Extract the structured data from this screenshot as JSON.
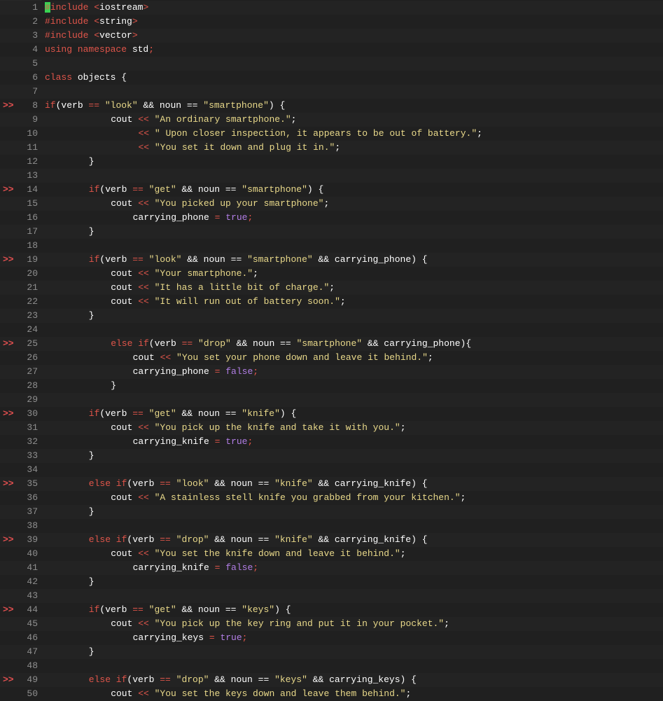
{
  "editor": {
    "language": "C++",
    "marker_glyph": ">>",
    "cursor_line": 1,
    "lines": [
      {
        "num": "1",
        "marker": false,
        "indent": 0,
        "tokens": [
          [
            "cursor",
            "#"
          ],
          [
            "pre",
            "include "
          ],
          [
            "op",
            "<"
          ],
          [
            "id",
            "iostream"
          ],
          [
            "op",
            ">"
          ]
        ]
      },
      {
        "num": "2",
        "marker": false,
        "indent": 0,
        "tokens": [
          [
            "pre",
            "#include "
          ],
          [
            "op",
            "<"
          ],
          [
            "id",
            "string"
          ],
          [
            "op",
            ">"
          ]
        ]
      },
      {
        "num": "3",
        "marker": false,
        "indent": 0,
        "tokens": [
          [
            "pre",
            "#include "
          ],
          [
            "op",
            "<"
          ],
          [
            "id",
            "vector"
          ],
          [
            "op",
            ">"
          ]
        ]
      },
      {
        "num": "4",
        "marker": false,
        "indent": 0,
        "tokens": [
          [
            "kw",
            "using namespace "
          ],
          [
            "id",
            "std"
          ],
          [
            "sem",
            ";"
          ]
        ]
      },
      {
        "num": "5",
        "marker": false,
        "indent": 0,
        "tokens": []
      },
      {
        "num": "6",
        "marker": false,
        "indent": 0,
        "tokens": [
          [
            "kw",
            "class "
          ],
          [
            "id",
            "objects {"
          ]
        ]
      },
      {
        "num": "7",
        "marker": false,
        "indent": 0,
        "tokens": []
      },
      {
        "num": "8",
        "marker": true,
        "indent": 0,
        "tokens": [
          [
            "kw",
            "if"
          ],
          [
            "id",
            "(verb "
          ],
          [
            "op",
            "=="
          ],
          [
            "id",
            " "
          ],
          [
            "str",
            "\"look\""
          ],
          [
            "id",
            " && noun == "
          ],
          [
            "str",
            "\"smartphone\""
          ],
          [
            "id",
            ") {"
          ]
        ]
      },
      {
        "num": "9",
        "marker": false,
        "indent": 12,
        "tokens": [
          [
            "id",
            "cout "
          ],
          [
            "op",
            "<<"
          ],
          [
            "id",
            " "
          ],
          [
            "str",
            "\"An ordinary smartphone.\""
          ],
          [
            "id",
            ";"
          ]
        ]
      },
      {
        "num": "10",
        "marker": false,
        "indent": 17,
        "tokens": [
          [
            "op",
            "<<"
          ],
          [
            "id",
            " "
          ],
          [
            "str",
            "\" Upon closer inspection, it appears to be out of battery.\""
          ],
          [
            "id",
            ";"
          ]
        ]
      },
      {
        "num": "11",
        "marker": false,
        "indent": 17,
        "tokens": [
          [
            "op",
            "<<"
          ],
          [
            "id",
            " "
          ],
          [
            "str",
            "\"You set it down and plug it in.\""
          ],
          [
            "id",
            ";"
          ]
        ]
      },
      {
        "num": "12",
        "marker": false,
        "indent": 8,
        "tokens": [
          [
            "id",
            "}"
          ]
        ]
      },
      {
        "num": "13",
        "marker": false,
        "indent": 0,
        "tokens": []
      },
      {
        "num": "14",
        "marker": true,
        "indent": 8,
        "tokens": [
          [
            "kw",
            "if"
          ],
          [
            "id",
            "(verb "
          ],
          [
            "op",
            "=="
          ],
          [
            "id",
            " "
          ],
          [
            "str",
            "\"get\""
          ],
          [
            "id",
            " && noun == "
          ],
          [
            "str",
            "\"smartphone\""
          ],
          [
            "id",
            ") {"
          ]
        ]
      },
      {
        "num": "15",
        "marker": false,
        "indent": 12,
        "tokens": [
          [
            "id",
            "cout "
          ],
          [
            "op",
            "<<"
          ],
          [
            "id",
            " "
          ],
          [
            "str",
            "\"You picked up your smartphone\""
          ],
          [
            "id",
            ";"
          ]
        ]
      },
      {
        "num": "16",
        "marker": false,
        "indent": 16,
        "tokens": [
          [
            "id",
            "carrying_phone "
          ],
          [
            "op",
            "="
          ],
          [
            "id",
            " "
          ],
          [
            "bool",
            "true"
          ],
          [
            "sem",
            ";"
          ]
        ]
      },
      {
        "num": "17",
        "marker": false,
        "indent": 8,
        "tokens": [
          [
            "id",
            "}"
          ]
        ]
      },
      {
        "num": "18",
        "marker": false,
        "indent": 0,
        "tokens": []
      },
      {
        "num": "19",
        "marker": true,
        "indent": 8,
        "tokens": [
          [
            "kw",
            "if"
          ],
          [
            "id",
            "(verb "
          ],
          [
            "op",
            "=="
          ],
          [
            "id",
            " "
          ],
          [
            "str",
            "\"look\""
          ],
          [
            "id",
            " && noun == "
          ],
          [
            "str",
            "\"smartphone\""
          ],
          [
            "id",
            " && carrying_phone) {"
          ]
        ]
      },
      {
        "num": "20",
        "marker": false,
        "indent": 12,
        "tokens": [
          [
            "id",
            "cout "
          ],
          [
            "op",
            "<<"
          ],
          [
            "id",
            " "
          ],
          [
            "str",
            "\"Your smartphone.\""
          ],
          [
            "id",
            ";"
          ]
        ]
      },
      {
        "num": "21",
        "marker": false,
        "indent": 12,
        "tokens": [
          [
            "id",
            "cout "
          ],
          [
            "op",
            "<<"
          ],
          [
            "id",
            " "
          ],
          [
            "str",
            "\"It has a little bit of charge.\""
          ],
          [
            "id",
            ";"
          ]
        ]
      },
      {
        "num": "22",
        "marker": false,
        "indent": 12,
        "tokens": [
          [
            "id",
            "cout "
          ],
          [
            "op",
            "<<"
          ],
          [
            "id",
            " "
          ],
          [
            "str",
            "\"It will run out of battery soon.\""
          ],
          [
            "id",
            ";"
          ]
        ]
      },
      {
        "num": "23",
        "marker": false,
        "indent": 8,
        "tokens": [
          [
            "id",
            "}"
          ]
        ]
      },
      {
        "num": "24",
        "marker": false,
        "indent": 0,
        "tokens": []
      },
      {
        "num": "25",
        "marker": true,
        "indent": 12,
        "tokens": [
          [
            "kw",
            "else if"
          ],
          [
            "id",
            "(verb "
          ],
          [
            "op",
            "=="
          ],
          [
            "id",
            " "
          ],
          [
            "str",
            "\"drop\""
          ],
          [
            "id",
            " && noun == "
          ],
          [
            "str",
            "\"smartphone\""
          ],
          [
            "id",
            " && carrying_phone){"
          ]
        ]
      },
      {
        "num": "26",
        "marker": false,
        "indent": 16,
        "tokens": [
          [
            "id",
            "cout "
          ],
          [
            "op",
            "<<"
          ],
          [
            "id",
            " "
          ],
          [
            "str",
            "\"You set your phone down and leave it behind.\""
          ],
          [
            "id",
            ";"
          ]
        ]
      },
      {
        "num": "27",
        "marker": false,
        "indent": 16,
        "tokens": [
          [
            "id",
            "carrying_phone "
          ],
          [
            "op",
            "="
          ],
          [
            "id",
            " "
          ],
          [
            "bool",
            "false"
          ],
          [
            "sem",
            ";"
          ]
        ]
      },
      {
        "num": "28",
        "marker": false,
        "indent": 12,
        "tokens": [
          [
            "id",
            "}"
          ]
        ]
      },
      {
        "num": "29",
        "marker": false,
        "indent": 0,
        "tokens": []
      },
      {
        "num": "30",
        "marker": true,
        "indent": 8,
        "tokens": [
          [
            "kw",
            "if"
          ],
          [
            "id",
            "(verb "
          ],
          [
            "op",
            "=="
          ],
          [
            "id",
            " "
          ],
          [
            "str",
            "\"get\""
          ],
          [
            "id",
            " && noun == "
          ],
          [
            "str",
            "\"knife\""
          ],
          [
            "id",
            ") {"
          ]
        ]
      },
      {
        "num": "31",
        "marker": false,
        "indent": 12,
        "tokens": [
          [
            "id",
            "cout "
          ],
          [
            "op",
            "<<"
          ],
          [
            "id",
            " "
          ],
          [
            "str",
            "\"You pick up the knife and take it with you.\""
          ],
          [
            "id",
            ";"
          ]
        ]
      },
      {
        "num": "32",
        "marker": false,
        "indent": 16,
        "tokens": [
          [
            "id",
            "carrying_knife "
          ],
          [
            "op",
            "="
          ],
          [
            "id",
            " "
          ],
          [
            "bool",
            "true"
          ],
          [
            "sem",
            ";"
          ]
        ]
      },
      {
        "num": "33",
        "marker": false,
        "indent": 8,
        "tokens": [
          [
            "id",
            "}"
          ]
        ]
      },
      {
        "num": "34",
        "marker": false,
        "indent": 0,
        "tokens": []
      },
      {
        "num": "35",
        "marker": true,
        "indent": 8,
        "tokens": [
          [
            "kw",
            "else if"
          ],
          [
            "id",
            "(verb "
          ],
          [
            "op",
            "=="
          ],
          [
            "id",
            " "
          ],
          [
            "str",
            "\"look\""
          ],
          [
            "id",
            " && noun == "
          ],
          [
            "str",
            "\"knife\""
          ],
          [
            "id",
            " && carrying_knife) {"
          ]
        ]
      },
      {
        "num": "36",
        "marker": false,
        "indent": 12,
        "tokens": [
          [
            "id",
            "cout "
          ],
          [
            "op",
            "<<"
          ],
          [
            "id",
            " "
          ],
          [
            "str",
            "\"A stainless stell knife you grabbed from your kitchen.\""
          ],
          [
            "id",
            ";"
          ]
        ]
      },
      {
        "num": "37",
        "marker": false,
        "indent": 8,
        "tokens": [
          [
            "id",
            "}"
          ]
        ]
      },
      {
        "num": "38",
        "marker": false,
        "indent": 0,
        "tokens": []
      },
      {
        "num": "39",
        "marker": true,
        "indent": 8,
        "tokens": [
          [
            "kw",
            "else if"
          ],
          [
            "id",
            "(verb "
          ],
          [
            "op",
            "=="
          ],
          [
            "id",
            " "
          ],
          [
            "str",
            "\"drop\""
          ],
          [
            "id",
            " && noun == "
          ],
          [
            "str",
            "\"knife\""
          ],
          [
            "id",
            " && carrying_knife) {"
          ]
        ]
      },
      {
        "num": "40",
        "marker": false,
        "indent": 12,
        "tokens": [
          [
            "id",
            "cout "
          ],
          [
            "op",
            "<<"
          ],
          [
            "id",
            " "
          ],
          [
            "str",
            "\"You set the knife down and leave it behind.\""
          ],
          [
            "id",
            ";"
          ]
        ]
      },
      {
        "num": "41",
        "marker": false,
        "indent": 16,
        "tokens": [
          [
            "id",
            "carrying_knife "
          ],
          [
            "op",
            "="
          ],
          [
            "id",
            " "
          ],
          [
            "bool",
            "false"
          ],
          [
            "sem",
            ";"
          ]
        ]
      },
      {
        "num": "42",
        "marker": false,
        "indent": 8,
        "tokens": [
          [
            "id",
            "}"
          ]
        ]
      },
      {
        "num": "43",
        "marker": false,
        "indent": 0,
        "tokens": []
      },
      {
        "num": "44",
        "marker": true,
        "indent": 8,
        "tokens": [
          [
            "kw",
            "if"
          ],
          [
            "id",
            "(verb "
          ],
          [
            "op",
            "=="
          ],
          [
            "id",
            " "
          ],
          [
            "str",
            "\"get\""
          ],
          [
            "id",
            " && noun == "
          ],
          [
            "str",
            "\"keys\""
          ],
          [
            "id",
            ") {"
          ]
        ]
      },
      {
        "num": "45",
        "marker": false,
        "indent": 12,
        "tokens": [
          [
            "id",
            "cout "
          ],
          [
            "op",
            "<<"
          ],
          [
            "id",
            " "
          ],
          [
            "str",
            "\"You pick up the key ring and put it in your pocket.\""
          ],
          [
            "id",
            ";"
          ]
        ]
      },
      {
        "num": "46",
        "marker": false,
        "indent": 16,
        "tokens": [
          [
            "id",
            "carrying_keys "
          ],
          [
            "op",
            "="
          ],
          [
            "id",
            " "
          ],
          [
            "bool",
            "true"
          ],
          [
            "sem",
            ";"
          ]
        ]
      },
      {
        "num": "47",
        "marker": false,
        "indent": 8,
        "tokens": [
          [
            "id",
            "}"
          ]
        ]
      },
      {
        "num": "48",
        "marker": false,
        "indent": 0,
        "tokens": []
      },
      {
        "num": "49",
        "marker": true,
        "indent": 8,
        "tokens": [
          [
            "kw",
            "else if"
          ],
          [
            "id",
            "(verb "
          ],
          [
            "op",
            "=="
          ],
          [
            "id",
            " "
          ],
          [
            "str",
            "\"drop\""
          ],
          [
            "id",
            " && noun == "
          ],
          [
            "str",
            "\"keys\""
          ],
          [
            "id",
            " && carrying_keys) {"
          ]
        ]
      },
      {
        "num": "50",
        "marker": false,
        "indent": 12,
        "tokens": [
          [
            "id",
            "cout "
          ],
          [
            "op",
            "<<"
          ],
          [
            "id",
            " "
          ],
          [
            "str",
            "\"You set the keys down and leave them behind.\""
          ],
          [
            "id",
            ";"
          ]
        ]
      }
    ]
  },
  "colors": {
    "background": "#1e1e1e",
    "keyword": "#e0554a",
    "string": "#e9d98a",
    "boolean": "#b27ee6",
    "line_number": "#8f8f8f",
    "marker": "#e04f4f",
    "cursor": "#39d353"
  }
}
